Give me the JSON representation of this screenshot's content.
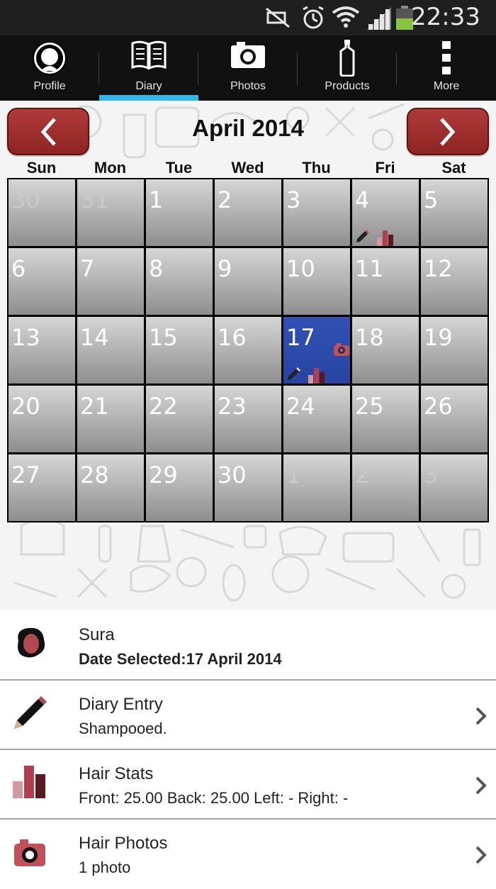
{
  "status_bar": {
    "time": "22:33",
    "icons": [
      "mute-icon",
      "alarm-icon",
      "wifi-icon",
      "signal-icon",
      "battery-icon"
    ]
  },
  "nav": {
    "tabs": [
      {
        "label": "Profile",
        "icon": "profile-icon"
      },
      {
        "label": "Diary",
        "icon": "book-icon",
        "selected": true
      },
      {
        "label": "Photos",
        "icon": "camera-icon"
      },
      {
        "label": "Products",
        "icon": "bottle-icon"
      },
      {
        "label": "More",
        "icon": "overflow-icon"
      }
    ],
    "accent": "#33b5e5"
  },
  "calendar": {
    "title": "April 2014",
    "weekdays": [
      "Sun",
      "Mon",
      "Tue",
      "Wed",
      "Thu",
      "Fri",
      "Sat"
    ],
    "weeks": [
      [
        "30",
        "31",
        "1",
        "2",
        "3",
        "4",
        "5"
      ],
      [
        "6",
        "7",
        "8",
        "9",
        "10",
        "11",
        "12"
      ],
      [
        "13",
        "14",
        "15",
        "16",
        "17",
        "18",
        "19"
      ],
      [
        "20",
        "21",
        "22",
        "23",
        "24",
        "25",
        "26"
      ],
      [
        "27",
        "28",
        "29",
        "30",
        "1",
        "2",
        "3"
      ]
    ],
    "selected_day": "17",
    "selected_color": "#2f4fb2",
    "nav_button_color": "#9e2f2f"
  },
  "list": {
    "profile": {
      "name": "Sura",
      "date_selected": "Date Selected:17 April 2014"
    },
    "diary": {
      "title": "Diary Entry",
      "detail": "Shampooed."
    },
    "stats": {
      "title": "Hair Stats",
      "detail": "Front: 25.00 Back: 25.00 Left: - Right: -"
    },
    "photos": {
      "title": "Hair Photos",
      "detail": "1 photo"
    }
  }
}
